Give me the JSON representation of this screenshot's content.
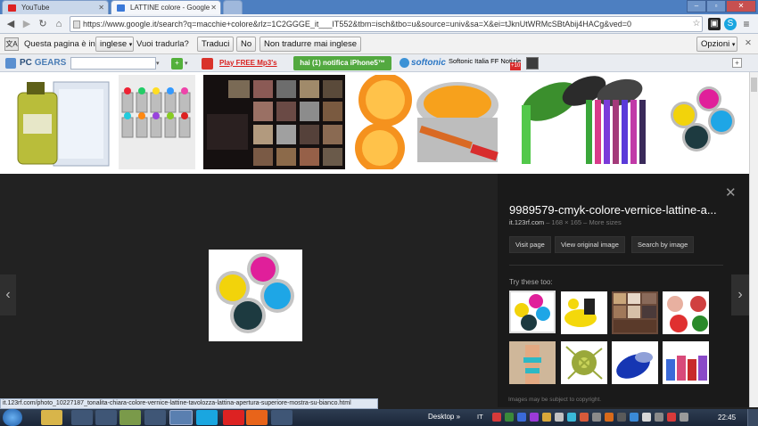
{
  "browser": {
    "tabs": [
      {
        "label": "YouTube"
      },
      {
        "label": "LATTINE colore - Google"
      }
    ],
    "address": "https://www.google.it/search?q=macchie+colore&rlz=1C2GGGE_it___IT552&tbm=isch&tbo=u&source=univ&sa=X&ei=tJknUtWRMcSBtAbij4HACg&ved=0"
  },
  "translate_bar": {
    "prompt": "Questa pagina è in",
    "language": "inglese",
    "question": "Vuoi tradurla?",
    "translate": "Traduci",
    "no": "No",
    "never": "Non tradurre mai inglese",
    "options": "Opzioni"
  },
  "extensions_bar": {
    "brand_pc": "PC",
    "brand_gears": "GEARS",
    "play_link": "Play FREE Mp3's",
    "notify": "hai (1) notifica iPhone5™",
    "softonic": "softonic",
    "news": "Softonic Italia FF Notizie",
    "badge": "+10"
  },
  "preview": {
    "title": "9989579-cmyk-colore-vernice-lattine-a...",
    "domain": "it.123rf.com",
    "meta": " – 168 × 165 – More sizes",
    "visit": "Visit page",
    "view": "View original image",
    "search": "Search by image",
    "try_label": "Try these too:",
    "copyright": "Images may be subject to copyright."
  },
  "status_url": "it.123rf.com/photo_10227187_tonalita-chiara-colore-vernice-lattine-tavolozza-lattina-apertura-superiore-mostra-su-bianco.html",
  "taskbar": {
    "desktop": "Desktop",
    "lang": "IT",
    "clock": "22:45"
  },
  "colors": {
    "cyan": "#1ea6e6",
    "magenta": "#e01f9a",
    "yellow": "#f2d30b",
    "black": "#1d3a40",
    "green": "#52c84a",
    "orange": "#f5921e"
  }
}
